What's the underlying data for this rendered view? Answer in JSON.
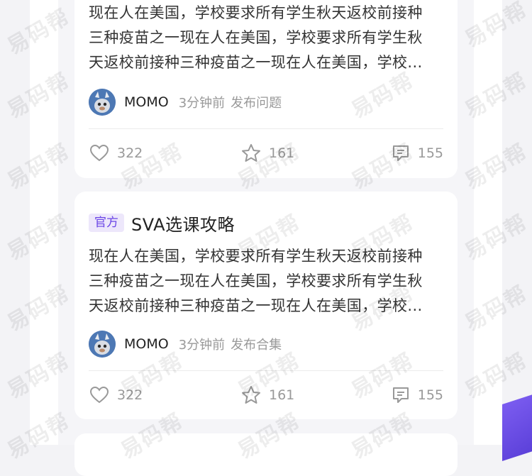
{
  "watermark": "易码帮",
  "cards": [
    {
      "excerpt_lines": [
        "现在人在美国，学校要求所有学生秋天返校前接种",
        "三种疫苗之一现在人在美国，学校要求所有学生秋",
        "天返校前接种三种疫苗之一现在人在美国，学校..."
      ],
      "author": "MOMO",
      "time": "3分钟前",
      "action": "发布问题",
      "likes": "322",
      "favorites": "161",
      "comments": "155"
    },
    {
      "tag": "官方",
      "title": "SVA选课攻略",
      "excerpt_lines": [
        "现在人在美国，学校要求所有学生秋天返校前接种",
        "三种疫苗之一现在人在美国，学校要求所有学生秋",
        "天返校前接种三种疫苗之一现在人在美国，学校..."
      ],
      "author": "MOMO",
      "time": "3分钟前",
      "action": "发布合集",
      "likes": "322",
      "favorites": "161",
      "comments": "155"
    }
  ],
  "colors": {
    "accent": "#6b46e6",
    "tag_bg": "#ede7fb",
    "muted_text": "#999999",
    "body_text": "#333333"
  },
  "icons": {
    "like": "heart-outline-icon",
    "favorite": "star-outline-icon",
    "comment": "comment-bubble-icon"
  }
}
